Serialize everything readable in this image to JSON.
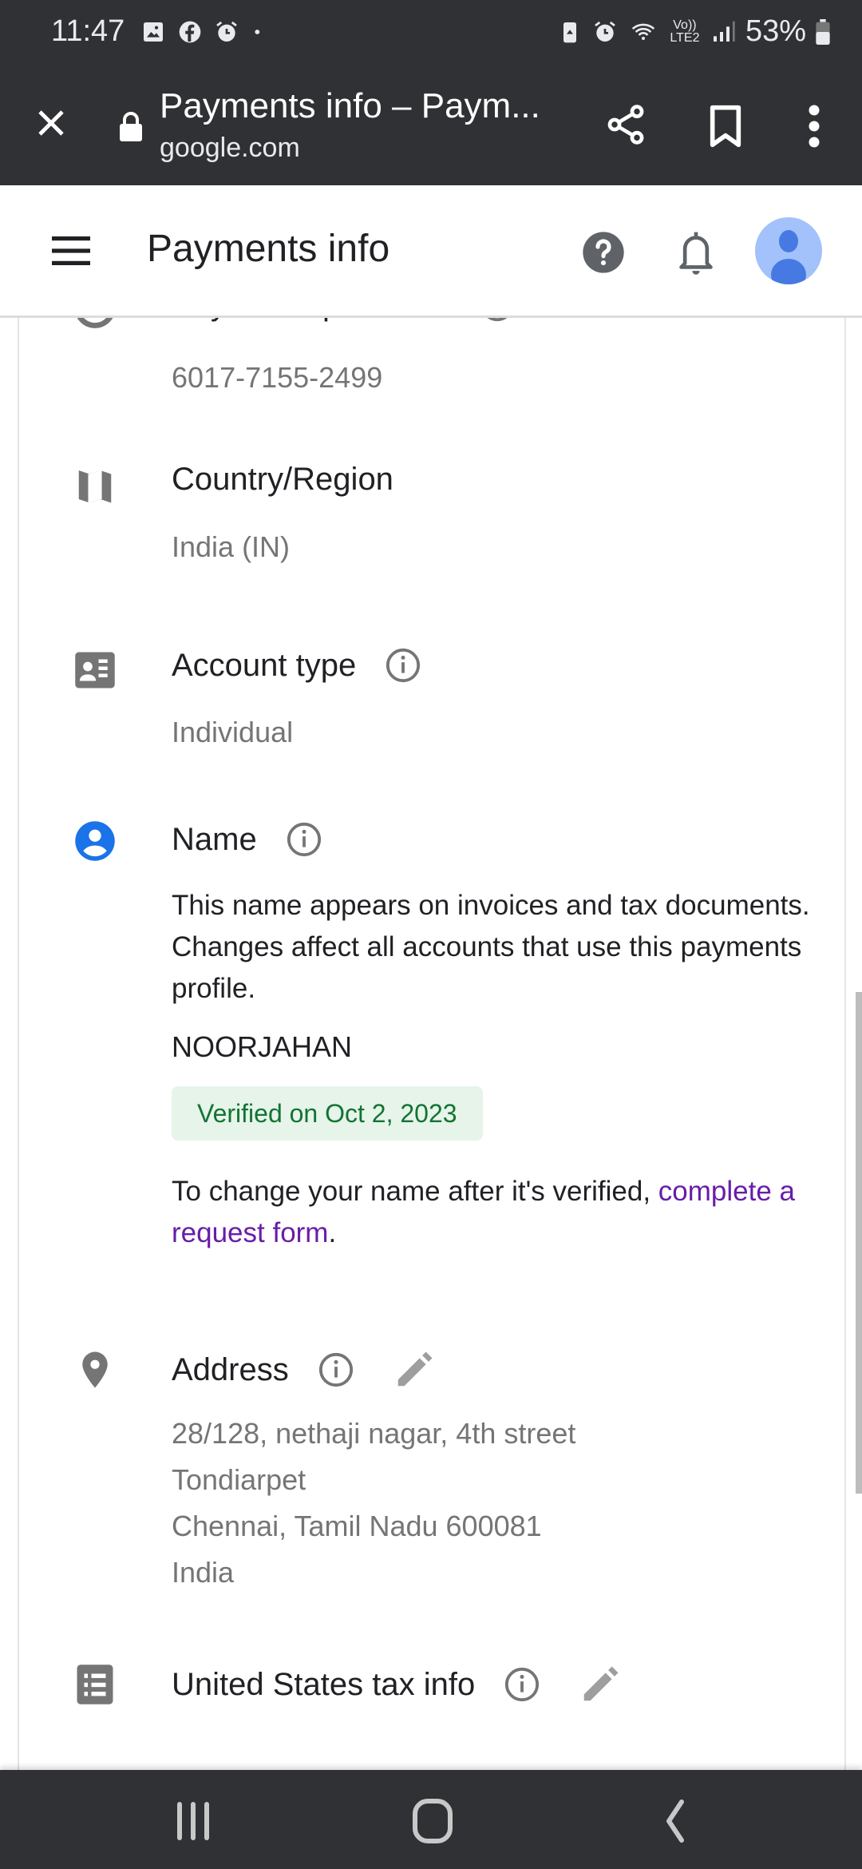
{
  "status_bar": {
    "time": "11:47",
    "left_icons": [
      "gallery-icon",
      "facebook-icon",
      "alarm-icon",
      "dot-icon"
    ],
    "right_icons": [
      "battery-saver-icon",
      "alarm-icon",
      "wifi-icon",
      "volte-lte2-icon",
      "signal-icon"
    ],
    "network_label": "Vo)) LTE2",
    "battery": "53%"
  },
  "browser": {
    "title": "Payments info – Paym...",
    "url": "google.com",
    "actions": [
      "close-icon",
      "share-icon",
      "bookmark-icon",
      "more-vert-icon"
    ]
  },
  "header": {
    "title": "Payments info",
    "icons": [
      "menu-icon",
      "help-icon",
      "notifications-icon",
      "account-avatar"
    ]
  },
  "sections": {
    "profile_id": {
      "label": "Payments profile ID",
      "value": "6017-7155-2499"
    },
    "country": {
      "label": "Country/Region",
      "value": "India (IN)"
    },
    "account_type": {
      "label": "Account type",
      "value": "Individual"
    },
    "name": {
      "label": "Name",
      "description": "This name appears on invoices and tax documents. Changes affect all accounts that use this payments profile.",
      "value": "NOORJAHAN",
      "verified_badge": "Verified on Oct 2, 2023",
      "change_note_prefix": "To change your name after it's verified, ",
      "change_link": "complete a request form",
      "change_note_suffix": "."
    },
    "address": {
      "label": "Address",
      "lines": [
        "28/128, nethaji nagar, 4th street",
        "Tondiarpet",
        "Chennai, Tamil Nadu 600081",
        "India"
      ]
    },
    "us_tax": {
      "label": "United States tax info"
    }
  },
  "colors": {
    "chrome_bg": "#303134",
    "accent_blue": "#1a73e8",
    "verified_bg": "#e6f4ea",
    "verified_text": "#137333",
    "link_visited": "#681da8",
    "secondary_text": "#757575",
    "icon_grey": "#757575"
  },
  "nav_bar": {
    "buttons": [
      "recents-icon",
      "home-icon",
      "back-icon"
    ]
  }
}
